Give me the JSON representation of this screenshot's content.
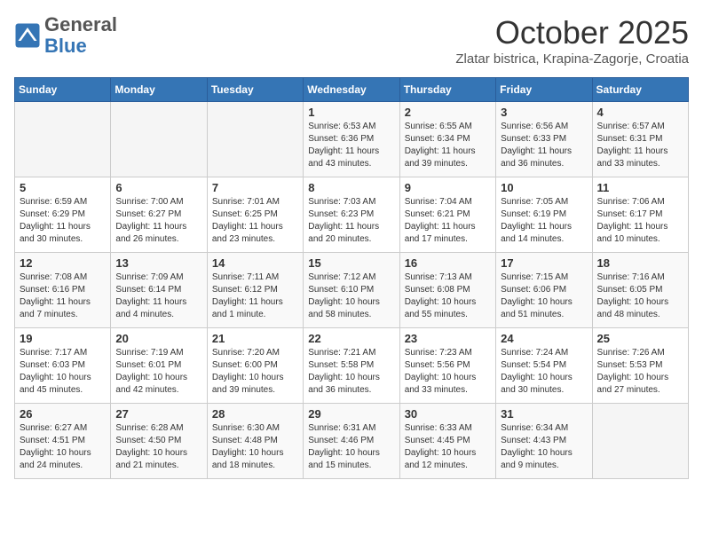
{
  "header": {
    "logo_general": "General",
    "logo_blue": "Blue",
    "month_title": "October 2025",
    "subtitle": "Zlatar bistrica, Krapina-Zagorje, Croatia"
  },
  "weekdays": [
    "Sunday",
    "Monday",
    "Tuesday",
    "Wednesday",
    "Thursday",
    "Friday",
    "Saturday"
  ],
  "weeks": [
    [
      {
        "day": "",
        "info": ""
      },
      {
        "day": "",
        "info": ""
      },
      {
        "day": "",
        "info": ""
      },
      {
        "day": "1",
        "info": "Sunrise: 6:53 AM\nSunset: 6:36 PM\nDaylight: 11 hours\nand 43 minutes."
      },
      {
        "day": "2",
        "info": "Sunrise: 6:55 AM\nSunset: 6:34 PM\nDaylight: 11 hours\nand 39 minutes."
      },
      {
        "day": "3",
        "info": "Sunrise: 6:56 AM\nSunset: 6:33 PM\nDaylight: 11 hours\nand 36 minutes."
      },
      {
        "day": "4",
        "info": "Sunrise: 6:57 AM\nSunset: 6:31 PM\nDaylight: 11 hours\nand 33 minutes."
      }
    ],
    [
      {
        "day": "5",
        "info": "Sunrise: 6:59 AM\nSunset: 6:29 PM\nDaylight: 11 hours\nand 30 minutes."
      },
      {
        "day": "6",
        "info": "Sunrise: 7:00 AM\nSunset: 6:27 PM\nDaylight: 11 hours\nand 26 minutes."
      },
      {
        "day": "7",
        "info": "Sunrise: 7:01 AM\nSunset: 6:25 PM\nDaylight: 11 hours\nand 23 minutes."
      },
      {
        "day": "8",
        "info": "Sunrise: 7:03 AM\nSunset: 6:23 PM\nDaylight: 11 hours\nand 20 minutes."
      },
      {
        "day": "9",
        "info": "Sunrise: 7:04 AM\nSunset: 6:21 PM\nDaylight: 11 hours\nand 17 minutes."
      },
      {
        "day": "10",
        "info": "Sunrise: 7:05 AM\nSunset: 6:19 PM\nDaylight: 11 hours\nand 14 minutes."
      },
      {
        "day": "11",
        "info": "Sunrise: 7:06 AM\nSunset: 6:17 PM\nDaylight: 11 hours\nand 10 minutes."
      }
    ],
    [
      {
        "day": "12",
        "info": "Sunrise: 7:08 AM\nSunset: 6:16 PM\nDaylight: 11 hours\nand 7 minutes."
      },
      {
        "day": "13",
        "info": "Sunrise: 7:09 AM\nSunset: 6:14 PM\nDaylight: 11 hours\nand 4 minutes."
      },
      {
        "day": "14",
        "info": "Sunrise: 7:11 AM\nSunset: 6:12 PM\nDaylight: 11 hours\nand 1 minute."
      },
      {
        "day": "15",
        "info": "Sunrise: 7:12 AM\nSunset: 6:10 PM\nDaylight: 10 hours\nand 58 minutes."
      },
      {
        "day": "16",
        "info": "Sunrise: 7:13 AM\nSunset: 6:08 PM\nDaylight: 10 hours\nand 55 minutes."
      },
      {
        "day": "17",
        "info": "Sunrise: 7:15 AM\nSunset: 6:06 PM\nDaylight: 10 hours\nand 51 minutes."
      },
      {
        "day": "18",
        "info": "Sunrise: 7:16 AM\nSunset: 6:05 PM\nDaylight: 10 hours\nand 48 minutes."
      }
    ],
    [
      {
        "day": "19",
        "info": "Sunrise: 7:17 AM\nSunset: 6:03 PM\nDaylight: 10 hours\nand 45 minutes."
      },
      {
        "day": "20",
        "info": "Sunrise: 7:19 AM\nSunset: 6:01 PM\nDaylight: 10 hours\nand 42 minutes."
      },
      {
        "day": "21",
        "info": "Sunrise: 7:20 AM\nSunset: 6:00 PM\nDaylight: 10 hours\nand 39 minutes."
      },
      {
        "day": "22",
        "info": "Sunrise: 7:21 AM\nSunset: 5:58 PM\nDaylight: 10 hours\nand 36 minutes."
      },
      {
        "day": "23",
        "info": "Sunrise: 7:23 AM\nSunset: 5:56 PM\nDaylight: 10 hours\nand 33 minutes."
      },
      {
        "day": "24",
        "info": "Sunrise: 7:24 AM\nSunset: 5:54 PM\nDaylight: 10 hours\nand 30 minutes."
      },
      {
        "day": "25",
        "info": "Sunrise: 7:26 AM\nSunset: 5:53 PM\nDaylight: 10 hours\nand 27 minutes."
      }
    ],
    [
      {
        "day": "26",
        "info": "Sunrise: 6:27 AM\nSunset: 4:51 PM\nDaylight: 10 hours\nand 24 minutes."
      },
      {
        "day": "27",
        "info": "Sunrise: 6:28 AM\nSunset: 4:50 PM\nDaylight: 10 hours\nand 21 minutes."
      },
      {
        "day": "28",
        "info": "Sunrise: 6:30 AM\nSunset: 4:48 PM\nDaylight: 10 hours\nand 18 minutes."
      },
      {
        "day": "29",
        "info": "Sunrise: 6:31 AM\nSunset: 4:46 PM\nDaylight: 10 hours\nand 15 minutes."
      },
      {
        "day": "30",
        "info": "Sunrise: 6:33 AM\nSunset: 4:45 PM\nDaylight: 10 hours\nand 12 minutes."
      },
      {
        "day": "31",
        "info": "Sunrise: 6:34 AM\nSunset: 4:43 PM\nDaylight: 10 hours\nand 9 minutes."
      },
      {
        "day": "",
        "info": ""
      }
    ]
  ]
}
